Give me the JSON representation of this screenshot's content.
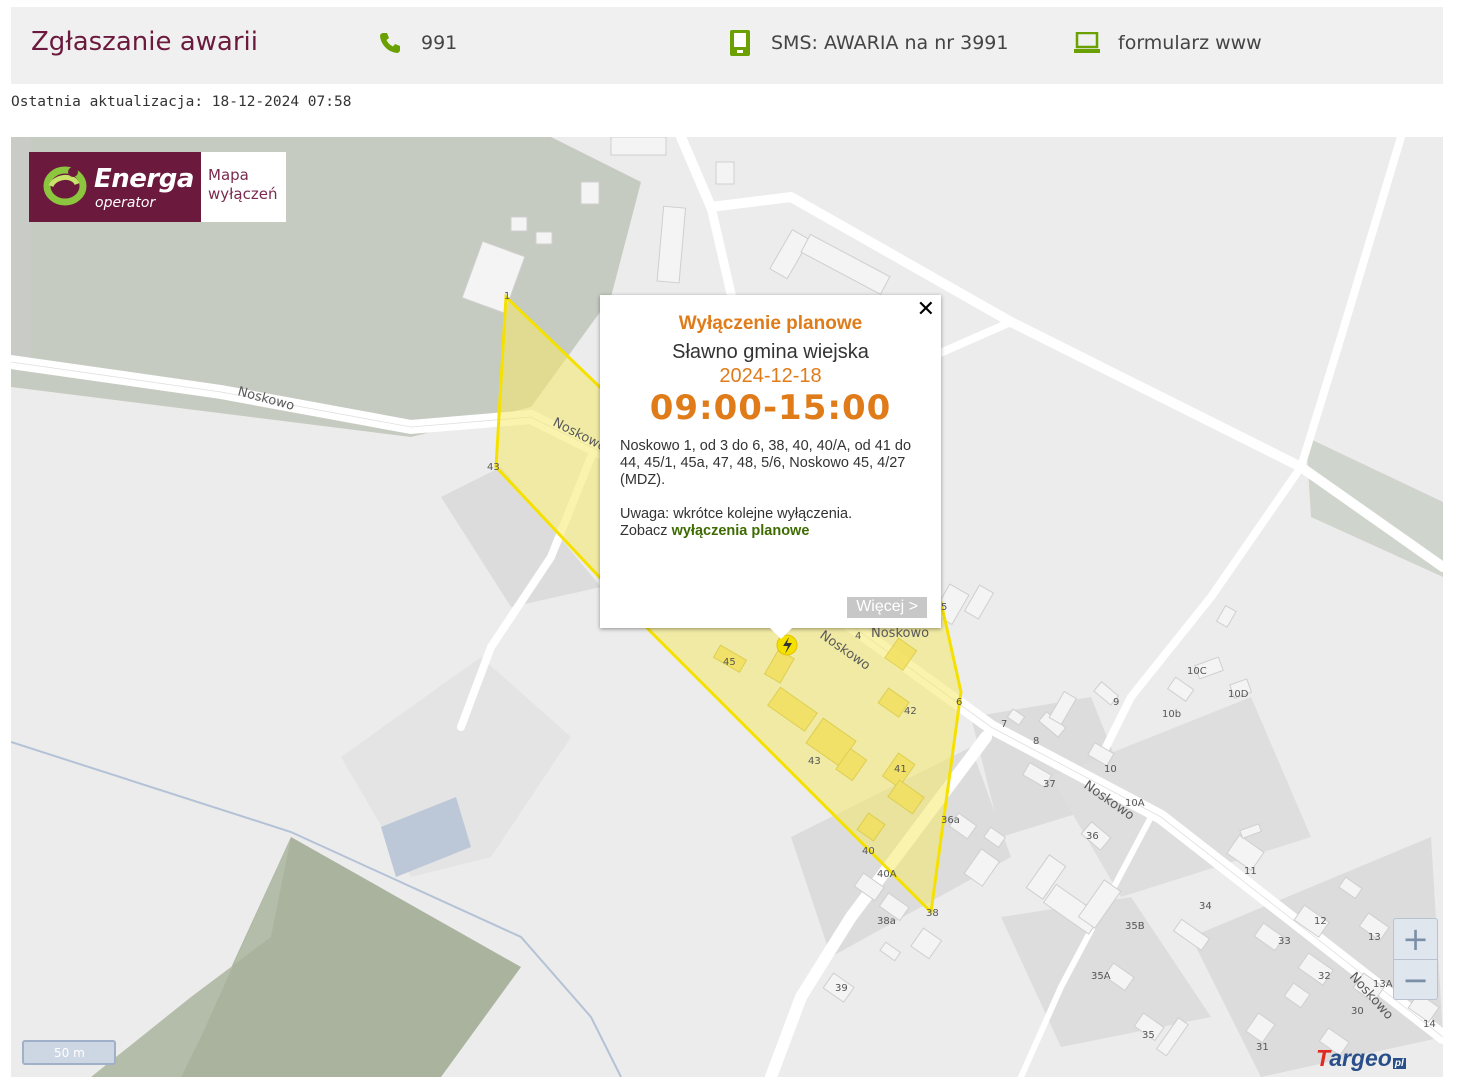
{
  "header": {
    "title": "Zgłaszanie awarii",
    "phone": "991",
    "sms": "SMS: AWARIA na nr 3991",
    "web": "formularz www"
  },
  "last_update": "Ostatnia aktualizacja: 18-12-2024 07:58",
  "colors": {
    "accent_green": "#6aa000",
    "brand": "#6b1a3e",
    "orange": "#e07b1a",
    "outage_fill": "#f5e96a"
  },
  "logo": {
    "brand": "Energa",
    "sub": "operator",
    "line1": "Mapa",
    "line2": "wyłączeń"
  },
  "popup": {
    "type": "Wyłączenie planowe",
    "place": "Sławno gmina wiejska",
    "date": "2024-12-18",
    "time": "09:00-15:00",
    "addresses": "Noskowo 1, od 3 do 6, 38, 40, 40/A, od 41 do 44, 45/1, 45a, 47, 48, 5/6, Noskowo 45, 4/27 (MDZ).",
    "note_prefix": "Uwaga: wkrótce kolejne wyłączenia.",
    "note_see": "Zobacz",
    "note_link": "wyłączenia planowe",
    "more": "Więcej >",
    "close": "✕"
  },
  "map": {
    "road_labels": [
      "Noskowo",
      "Noskowo",
      "Noskowo",
      "Noskowo",
      "Noskowo",
      "Noskowo"
    ],
    "house_numbers": [
      "1",
      "43",
      "45",
      "4",
      "5",
      "6",
      "42",
      "43",
      "41",
      "40",
      "40A",
      "38",
      "38a",
      "36a",
      "39",
      "7",
      "8",
      "9",
      "10",
      "10A",
      "10b",
      "10C",
      "10D",
      "11",
      "12",
      "13",
      "13A",
      "14",
      "30",
      "31",
      "32",
      "33",
      "34",
      "35",
      "35A",
      "35B",
      "36",
      "37"
    ],
    "zoom_in": "+",
    "zoom_out": "−",
    "scale": "50 m",
    "attribution_prefix": "T",
    "attribution": "argeo",
    "attribution_suffix": "pl"
  }
}
